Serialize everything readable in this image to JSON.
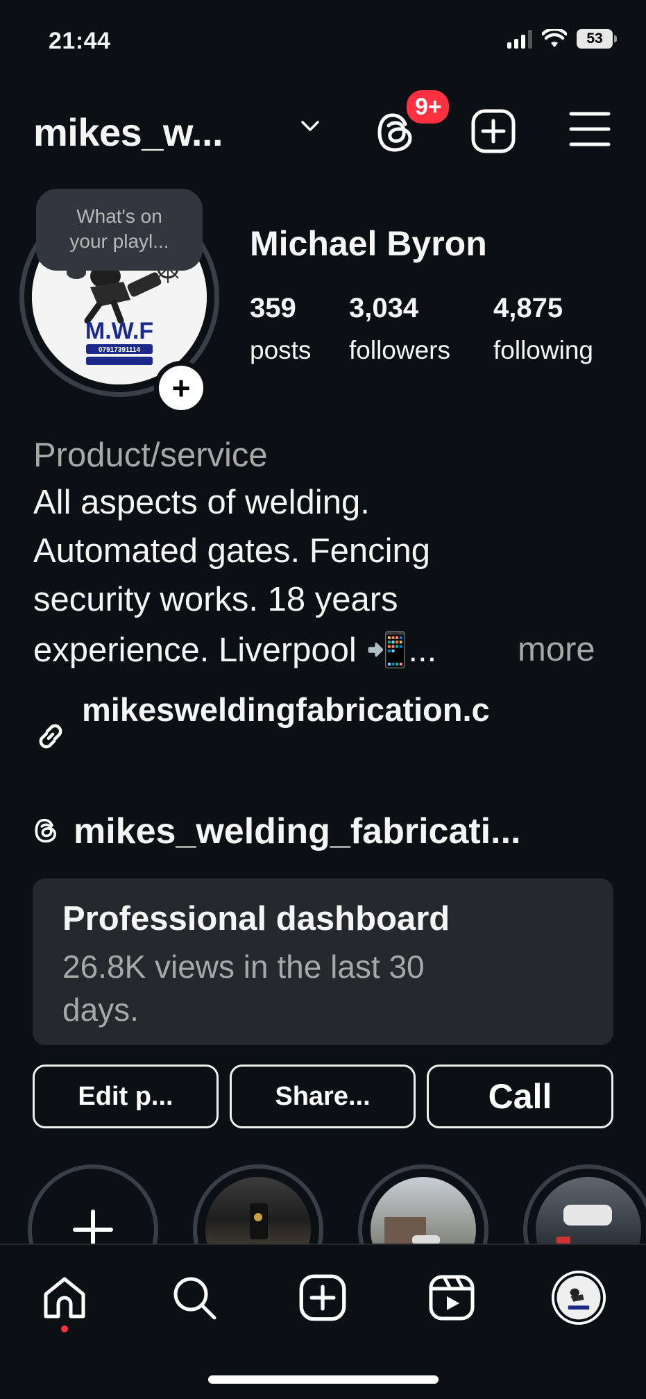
{
  "status_bar": {
    "time": "21:44",
    "battery": "53"
  },
  "header": {
    "username": "mikes_w...",
    "notification_badge": "9+"
  },
  "profile": {
    "note": "What's on your playl...",
    "note_line1": "What's on",
    "note_line2": "your playl...",
    "avatar_logo_text": "M.W.F",
    "avatar_phone": "07917391114",
    "display_name": "Michael Byron",
    "stats": {
      "posts": {
        "count": "359",
        "label": "posts"
      },
      "followers": {
        "count": "3,034",
        "label": "followers"
      },
      "following": {
        "count": "4,875",
        "label": "following"
      }
    },
    "category": "Product/service",
    "bio_lines": [
      "All aspects of welding.",
      "Automated gates. Fencing",
      "security works. 18 years",
      "experience. Liverpool 📲..."
    ],
    "bio_more": "more",
    "link": "mikesweldingfabrication.c",
    "threads_handle": "mikes_welding_fabricati..."
  },
  "dashboard": {
    "title": "Professional dashboard",
    "subtitle_line1": "26.8K views in the last 30",
    "subtitle_line2": "days."
  },
  "actions": {
    "edit": "Edit p...",
    "share": "Share...",
    "call": "Call"
  },
  "icons": {
    "chevron": "chevron-down-icon",
    "threads": "threads-icon",
    "create": "plus-square-icon",
    "menu": "hamburger-menu-icon",
    "link": "link-icon",
    "home": "home-icon",
    "search": "search-icon",
    "reels": "reels-icon"
  },
  "colors": {
    "background": "#0c1014",
    "badge": "#ff3040",
    "card": "#25292e",
    "muted_text": "#a8a8a8"
  }
}
